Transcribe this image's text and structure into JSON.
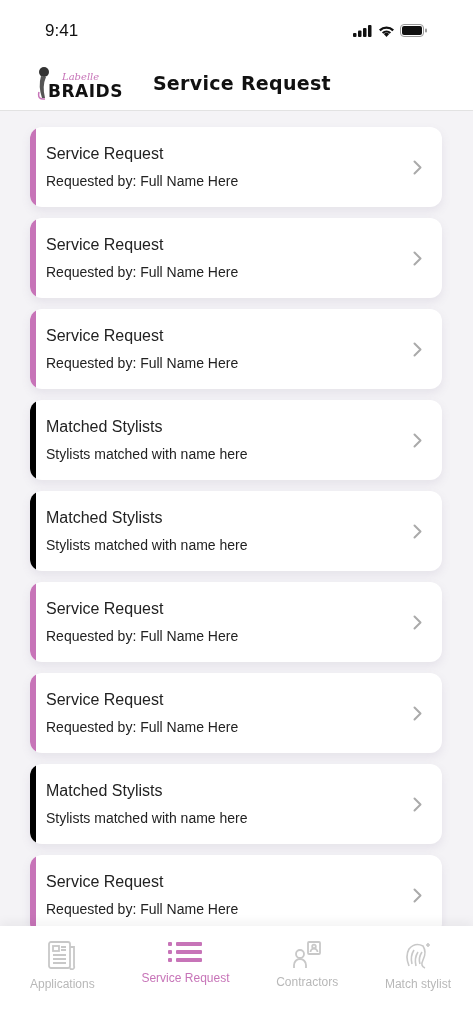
{
  "status_bar": {
    "time": "9:41"
  },
  "header": {
    "logo": {
      "script": "Labelle",
      "word": "BRAIDS"
    },
    "title": "Service Request"
  },
  "cards": [
    {
      "title": "Service Request",
      "subtitle": "Requested by: Full Name Here",
      "color": "#c774b8"
    },
    {
      "title": "Service Request",
      "subtitle": "Requested by: Full Name Here",
      "color": "#c774b8"
    },
    {
      "title": "Service Request",
      "subtitle": "Requested by: Full Name Here",
      "color": "#c774b8"
    },
    {
      "title": "Matched Stylists",
      "subtitle": "Stylists matched with name here",
      "color": "#000000"
    },
    {
      "title": "Matched Stylists",
      "subtitle": "Stylists matched with name here",
      "color": "#000000"
    },
    {
      "title": "Service Request",
      "subtitle": "Requested by: Full Name Here",
      "color": "#c774b8"
    },
    {
      "title": "Service Request",
      "subtitle": "Requested by: Full Name Here",
      "color": "#c774b8"
    },
    {
      "title": "Matched Stylists",
      "subtitle": "Stylists matched with name here",
      "color": "#000000"
    },
    {
      "title": "Service Request",
      "subtitle": "Requested by: Full Name Here",
      "color": "#c774b8"
    }
  ],
  "tab_bar": [
    {
      "label": "Applications",
      "selected": false
    },
    {
      "label": "Service Request",
      "selected": true
    },
    {
      "label": "Contractors",
      "selected": false
    },
    {
      "label": "Match stylist",
      "selected": false
    }
  ]
}
